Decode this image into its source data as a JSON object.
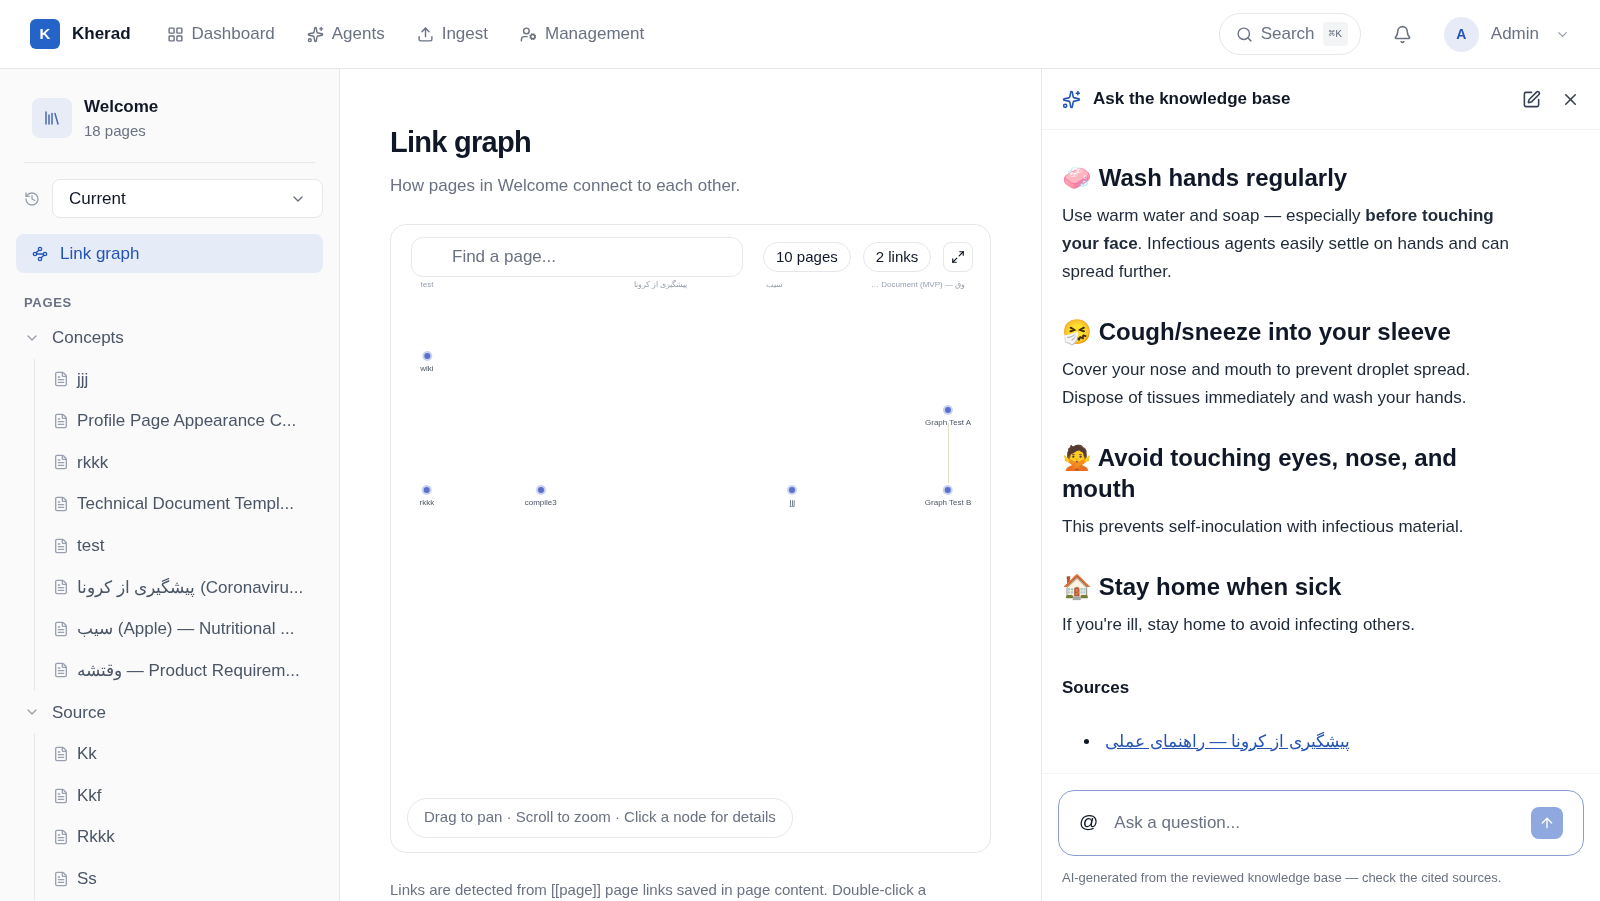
{
  "topbar": {
    "logo_letter": "K",
    "brand": "Kherad",
    "nav": [
      {
        "label": "Dashboard"
      },
      {
        "label": "Agents"
      },
      {
        "label": "Ingest"
      },
      {
        "label": "Management"
      }
    ],
    "search": {
      "label": "Search",
      "shortcut": "⌘K"
    },
    "user": {
      "initial": "A",
      "name": "Admin"
    }
  },
  "sidebar": {
    "space": {
      "title": "Welcome",
      "subtitle": "18 pages"
    },
    "version_select": "Current",
    "active_link": {
      "label": "Link graph",
      "selected": true
    },
    "section_label": "PAGES",
    "tree": [
      {
        "label": "Concepts",
        "expanded": true,
        "children": [
          {
            "label": "jjj"
          },
          {
            "label": "Profile Page Appearance C..."
          },
          {
            "label": "rkkk"
          },
          {
            "label": "Technical Document Templ..."
          },
          {
            "label": "test"
          },
          {
            "label": "پیشگیری از کرونا (Coronaviru..."
          },
          {
            "label": "سیب (Apple) — Nutritional ..."
          },
          {
            "label": "وقتشه — Product Requirem..."
          }
        ]
      },
      {
        "label": "Source",
        "expanded": true,
        "children": [
          {
            "label": "Kk"
          },
          {
            "label": "Kkf"
          },
          {
            "label": "Rkkk"
          },
          {
            "label": "Ss"
          }
        ]
      }
    ]
  },
  "main": {
    "title": "Link graph",
    "subtitle": "How pages in Welcome connect to each other.",
    "search": {
      "placeholder": "Find a page..."
    },
    "pages_count": "10 pages",
    "links_count": "2 links",
    "nodes": [
      {
        "label": "test",
        "kind": "label"
      },
      {
        "label": "پیشگیری از کرونا",
        "kind": "label"
      },
      {
        "label": "سیب",
        "kind": "label"
      },
      {
        "label": "… Document (MVP) — وق",
        "kind": "label"
      },
      {
        "label": "wiki",
        "kind": "node"
      },
      {
        "label": "Graph Test A",
        "kind": "node"
      },
      {
        "label": "rkkk",
        "kind": "node"
      },
      {
        "label": "compile3",
        "kind": "node"
      },
      {
        "label": "jjj",
        "kind": "node"
      },
      {
        "label": "Graph Test B",
        "kind": "node"
      }
    ],
    "hint": "Drag to pan · Scroll to zoom · Click a node for details",
    "footer": "Links are detected from [[page]] page links saved in page content. Double-click a"
  },
  "assistant": {
    "title": "Ask the knowledge base",
    "sections": [
      {
        "heading": "🧼 Wash hands regularly",
        "body": "Use warm water and soap — especially **before touching your face**. Infectious agents easily settle on hands and can spread further."
      },
      {
        "heading": "🤧 Cough/sneeze into your sleeve",
        "body": "Cover your nose and mouth to prevent droplet spread. Dispose of tissues immediately and wash your hands."
      },
      {
        "heading": "🙅 Avoid touching eyes, nose, and mouth",
        "body": "This prevents self-inoculation with infectious material."
      },
      {
        "heading": "🏠 Stay home when sick",
        "body": "If you're ill, stay home to avoid infecting others."
      }
    ],
    "sources_label": "Sources",
    "sources": [
      "پیشگیری از کرونا — راهنمای عملی"
    ],
    "input": {
      "mention": "@",
      "placeholder": "Ask a question..."
    },
    "disclaimer": "AI-generated from the reviewed knowledge base — check the cited sources."
  }
}
